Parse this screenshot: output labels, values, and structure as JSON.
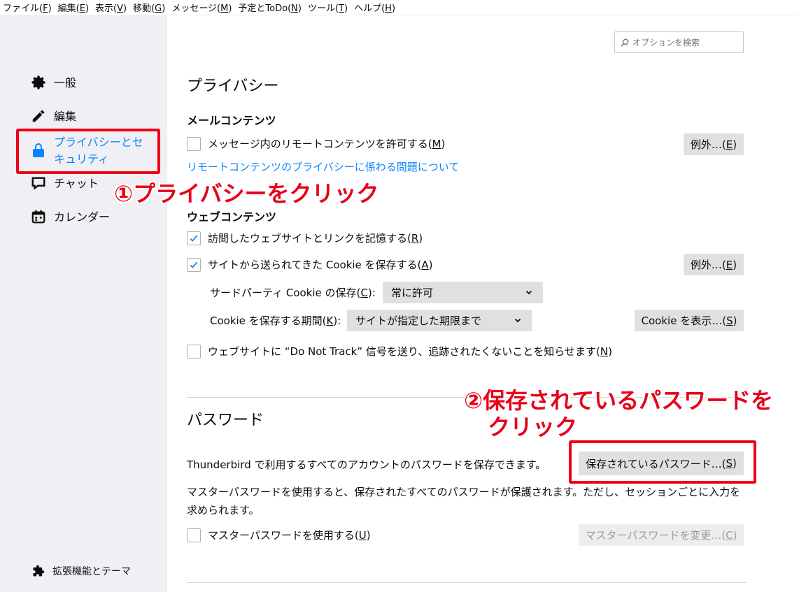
{
  "menubar": {
    "items": [
      {
        "label": "ファイル(",
        "key": "F",
        "end": ")"
      },
      {
        "label": "編集(",
        "key": "E",
        "end": ")"
      },
      {
        "label": "表示(",
        "key": "V",
        "end": ")"
      },
      {
        "label": "移動(",
        "key": "G",
        "end": ")"
      },
      {
        "label": "メッセージ(",
        "key": "M",
        "end": ")"
      },
      {
        "label": "予定とToDo(",
        "key": "N",
        "end": ")"
      },
      {
        "label": "ツール(",
        "key": "T",
        "end": ")"
      },
      {
        "label": "ヘルプ(",
        "key": "H",
        "end": ")"
      }
    ]
  },
  "search": {
    "placeholder": "オプションを検索"
  },
  "sidebar": {
    "items": [
      {
        "label": "一般",
        "icon": "gear-icon"
      },
      {
        "label": "編集",
        "icon": "pencil-icon"
      },
      {
        "label": "プライバシーとセキュリティ",
        "icon": "lock-icon",
        "selected": true
      },
      {
        "label": "チャット",
        "icon": "chat-icon"
      },
      {
        "label": "カレンダー",
        "icon": "calendar-icon"
      }
    ],
    "addons": {
      "label": "拡張機能とテーマ",
      "icon": "puzzle-icon"
    }
  },
  "privacy": {
    "title": "プライバシー",
    "mail_content": {
      "heading": "メールコンテンツ",
      "remote_label": "メッセージ内のリモートコンテンツを許可する(",
      "remote_key": "M",
      "remote_checked": false,
      "exceptions_label": "例外…(",
      "exceptions_key": "E",
      "link": "リモートコンテンツのプライバシーに係わる問題について"
    },
    "web_content": {
      "heading": "ウェブコンテンツ",
      "history_label": "訪問したウェブサイトとリンクを記憶する(",
      "history_key": "R",
      "history_checked": true,
      "cookie_label": "サイトから送られてきた Cookie を保存する(",
      "cookie_key": "A",
      "cookie_checked": true,
      "exceptions_label": "例外…(",
      "exceptions_key": "E",
      "third_party_label": "サードパーティ Cookie の保存(",
      "third_party_key": "C",
      "third_party_value": "常に許可",
      "keep_until_label": "Cookie を保存する期間(",
      "keep_until_key": "K",
      "keep_until_value": "サイトが指定した期限まで",
      "show_cookies_label": "Cookie を表示…(",
      "show_cookies_key": "S",
      "dnt_label": "ウェブサイトに “Do Not Track” 信号を送り、追跡されたくないことを知らせます(",
      "dnt_key": "N",
      "dnt_checked": false
    }
  },
  "passwords": {
    "title": "パスワード",
    "description": "Thunderbird で利用するすべてのアカウントのパスワードを保存できます。",
    "saved_button_label": "保存されているパスワード…(",
    "saved_button_key": "S",
    "master_description": "マスターパスワードを使用すると、保存されたすべてのパスワードが保護されます。ただし、セッションごとに入力を求められます。",
    "use_master_label": "マスターパスワードを使用する(",
    "use_master_key": "U",
    "use_master_checked": false,
    "change_master_label": "マスターパスワードを変更…(",
    "change_master_key": "C"
  },
  "annotations": {
    "step1": "①プライバシーをクリック",
    "step2_line1": "②保存されているパスワードを",
    "step2_line2": "クリック"
  },
  "colors": {
    "accent": "#0a84ff",
    "annotation_red": "#e8001a",
    "sidebar_bg": "#f0f0f4"
  }
}
